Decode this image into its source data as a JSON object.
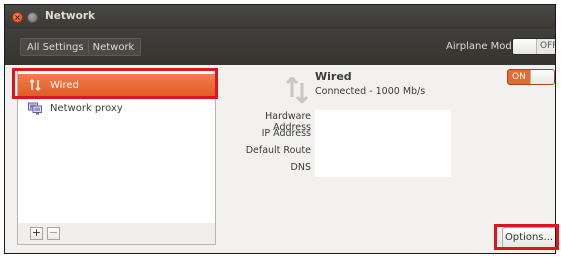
{
  "window": {
    "title": "Network",
    "close_glyph": "×"
  },
  "toolbar": {
    "breadcrumbs": [
      "All Settings",
      "Network"
    ],
    "airplane_mode_label": "Airplane Mode",
    "airplane_mode_state": "OFF"
  },
  "sidebar": {
    "items": [
      {
        "label": "Wired",
        "icon": "wired-arrows-icon",
        "selected": true
      },
      {
        "label": "Network proxy",
        "icon": "network-proxy-icon",
        "selected": false
      }
    ],
    "add_label": "+",
    "remove_label": "−"
  },
  "connection": {
    "name": "Wired",
    "status": "Connected - 1000 Mb/s",
    "switch_state": "ON",
    "fields": [
      {
        "label": "Hardware Address",
        "value": ""
      },
      {
        "label": "IP Address",
        "value": ""
      },
      {
        "label": "Default Route",
        "value": ""
      },
      {
        "label": "DNS",
        "value": ""
      }
    ]
  },
  "options_label": "Options...",
  "colors": {
    "accent": "#e86a32",
    "highlight_box": "#e0141c",
    "titlebar": "#3c3b37"
  }
}
